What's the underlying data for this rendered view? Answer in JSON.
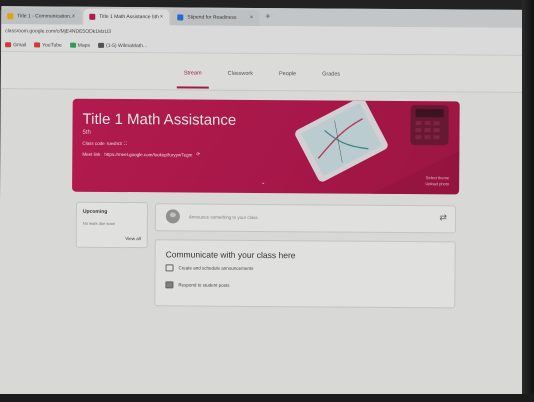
{
  "browser": {
    "tabs": [
      {
        "label": "Title 1 - Communication...",
        "close": "×",
        "color": "#f4b400"
      },
      {
        "label": "Title 1 Math Assistance 5th",
        "close": "×",
        "color": "#c4134f"
      },
      {
        "label": "Stipend for Readiness",
        "close": "×",
        "color": "#1a73e8"
      }
    ],
    "new_tab": "+",
    "url": "classroom.google.com/c/MjE4NDE5ODk1MzU3",
    "bookmarks": [
      {
        "label": "Gmail",
        "color": "#e53935"
      },
      {
        "label": "YouTube",
        "color": "#e53935"
      },
      {
        "label": "Maps",
        "color": "#34a853"
      },
      {
        "label": "(1-5) WilmaMath...",
        "color": "#555555"
      }
    ]
  },
  "nav": {
    "tabs": [
      "Stream",
      "Classwork",
      "People",
      "Grades"
    ],
    "active_index": 0,
    "accent": "#b0144a"
  },
  "banner": {
    "title": "Title 1 Math Assistance",
    "section": "5th",
    "class_code_label": "Class code",
    "class_code": "rueshr3",
    "class_code_icon": "⛶",
    "meet_label": "Meet link",
    "meet_url": "https://meet.google.com/lookup/furyyw7egm",
    "meet_icon": "⟳",
    "select_theme": "Select theme",
    "upload_photo": "Upload photo",
    "chevron": "⌄",
    "color": "#c4134f"
  },
  "upcoming": {
    "title": "Upcoming",
    "empty": "No work due soon",
    "view_all": "View all"
  },
  "announce": {
    "placeholder": "Announce something to your class",
    "repost_icon": "⇄"
  },
  "communicate": {
    "title": "Communicate with your class here",
    "items": [
      {
        "label": "Create and schedule announcements",
        "icon": "comment-icon"
      },
      {
        "label": "Respond to student posts",
        "icon": "reply-icon"
      }
    ]
  }
}
